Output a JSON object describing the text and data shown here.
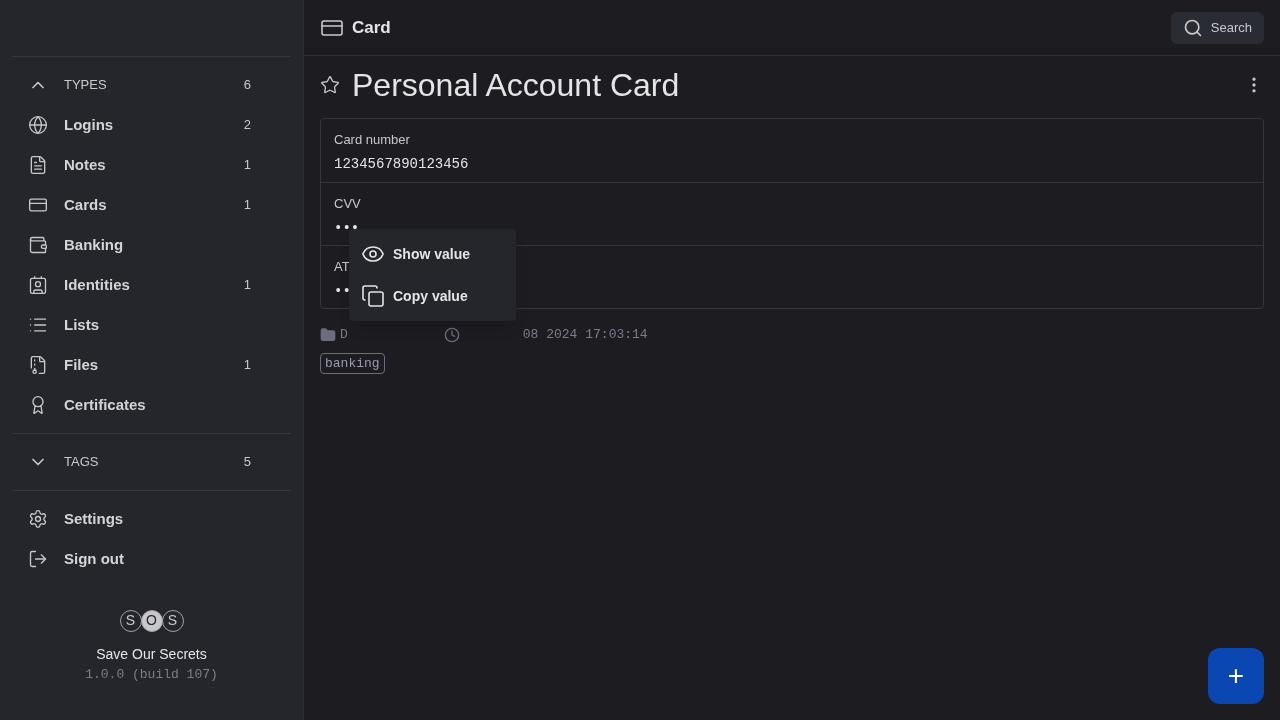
{
  "sidebar": {
    "sections": [
      {
        "label": "TYPES",
        "count": "6",
        "expanded": true,
        "items": [
          {
            "label": "Logins",
            "count": "2"
          },
          {
            "label": "Notes",
            "count": "1"
          },
          {
            "label": "Cards",
            "count": "1"
          },
          {
            "label": "Banking"
          },
          {
            "label": "Identities",
            "count": "1"
          },
          {
            "label": "Lists"
          },
          {
            "label": "Files",
            "count": "1"
          },
          {
            "label": "Certificates"
          }
        ]
      },
      {
        "label": "TAGS",
        "count": "5",
        "expanded": false
      }
    ],
    "footer_items": [
      {
        "label": "Settings"
      },
      {
        "label": "Sign out"
      }
    ],
    "logo_letters": [
      "S",
      "O",
      "S"
    ],
    "app_name": "Save Our Secrets",
    "version": "1.0.0 (build 107)"
  },
  "header": {
    "title": "Card",
    "search": "Search"
  },
  "item": {
    "title": "Personal Account Card",
    "starred": false,
    "fields": [
      {
        "label": "Card number",
        "value": "1234567890123456"
      },
      {
        "label": "CVV",
        "value": "•••"
      },
      {
        "label": "AT",
        "value": "••"
      }
    ],
    "folder": "D",
    "date": "08 2024 17:03:14",
    "tags": [
      "banking"
    ]
  },
  "context_menu": [
    {
      "label": "Show value"
    },
    {
      "label": "Copy value"
    }
  ],
  "fab": "+"
}
